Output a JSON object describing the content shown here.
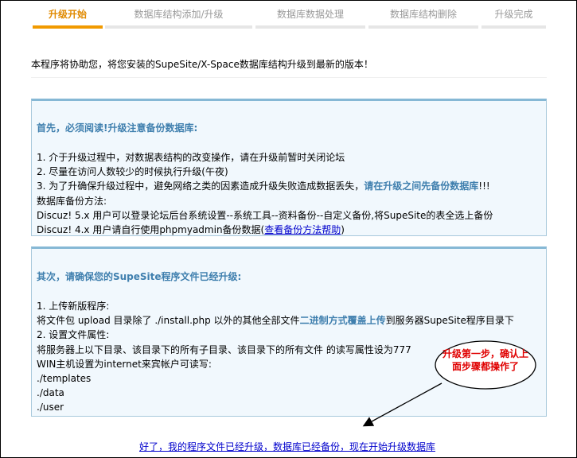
{
  "steps": [
    {
      "label": "升级开始",
      "active": true
    },
    {
      "label": "数据库结构添加/升级",
      "active": false
    },
    {
      "label": "数据库数据处理",
      "active": false
    },
    {
      "label": "数据库结构删除",
      "active": false
    },
    {
      "label": "升级完成",
      "active": false
    }
  ],
  "intro": "本程序将协助您，将您安装的SupeSite/X-Space数据库结构升级到最新的版本！",
  "panel1": {
    "title": "首先，必须阅读!升级注意备份数据库:",
    "line1": "1. 介于升级过程中，对数据表结构的改变操作，请在升级前暂时关闭论坛",
    "line2": "2. 尽量在访问人数较少的时候执行升级(午夜)",
    "line3_pre": "3. 为了升确保升级过程中，避免网络之类的因素造成升级失败造成数据丢失，",
    "line3_hl": "请在升级之间先备份数据库",
    "line3_post": "!!!",
    "line4": "数据库备份方法:",
    "line5": "Discuz! 5.x 用户可以登录论坛后台系统设置--系统工具--资料备份--自定义备份,将SupeSite的表全选上备份",
    "line6_pre": "Discuz! 4.x 用户请自行使用phpmyadmin备份数据(",
    "line6_link": "查看备份方法帮助",
    "line6_post": ")"
  },
  "panel2": {
    "title": "其次，请确保您的SupeSite程序文件已经升级:",
    "line1": "1. 上传新版程序:",
    "line2_pre": "将文件包  upload 目录除了  ./install.php 以外的其他全部文件",
    "line2_hl": "二进制方式覆盖上传",
    "line2_post": "到服务器SupeSite程序目录下",
    "line3": "2. 设置文件属性:",
    "line4": "将服务器上以下目录、该目录下的所有子目录、该目录下的所有文件  的读写属性设为777",
    "line5": "WIN主机设置为internet来宾帐户可读写:",
    "dirs": [
      "./templates",
      "./data",
      "./user"
    ]
  },
  "bottom_link": "好了，我的程序文件已经升级，数据库已经备份，现在开始升级数据库",
  "callout": {
    "line1": "升级第一步，确认上",
    "line2": "面步骤都操作了"
  },
  "colors": {
    "accent": "#f19a00",
    "highlight": "#3f7fae",
    "callout_text": "#e00000",
    "link": "#0000cc"
  }
}
